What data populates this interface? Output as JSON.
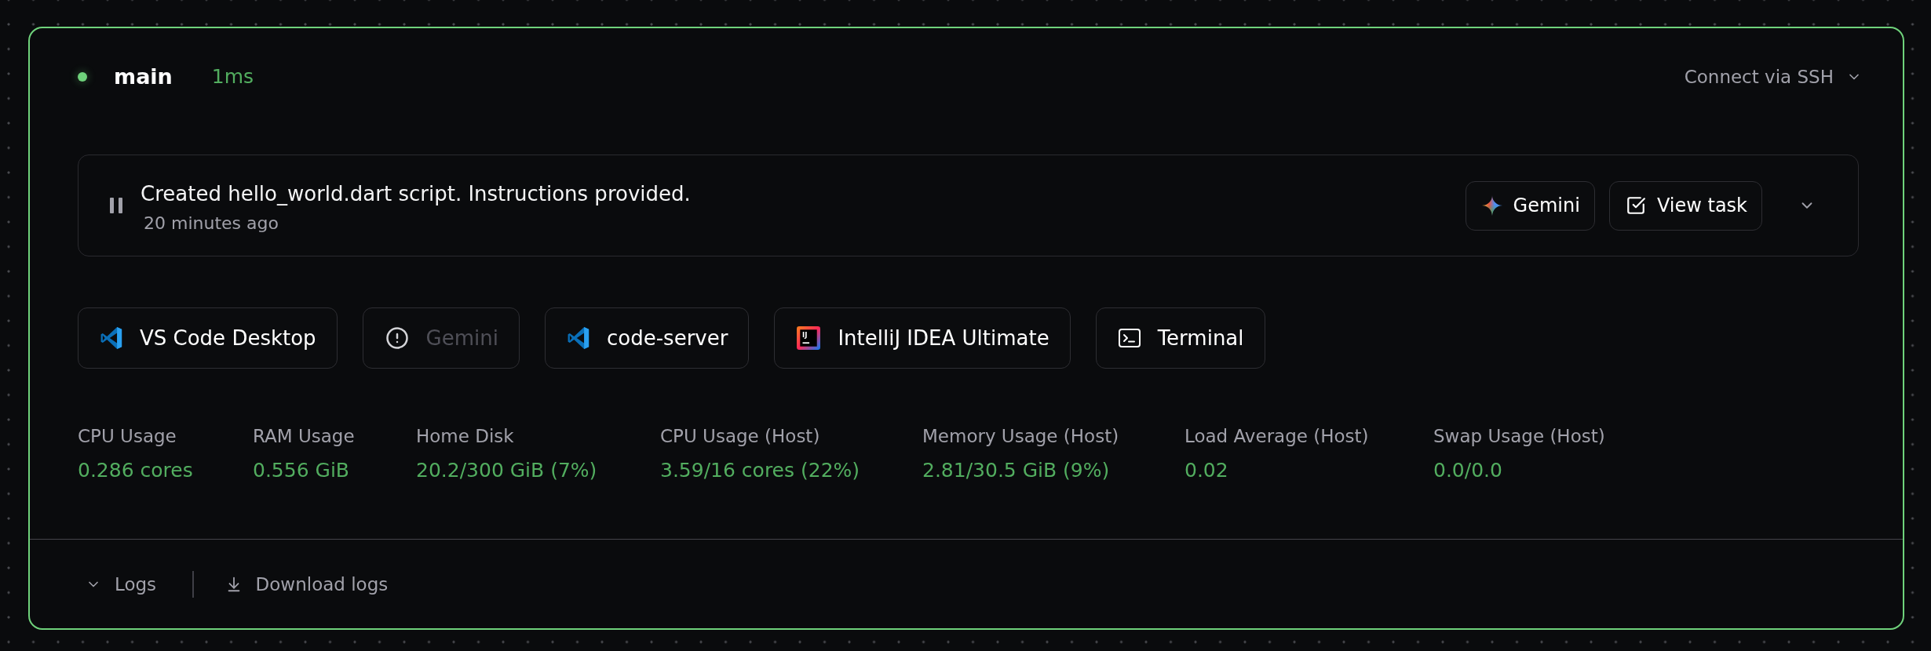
{
  "workspace": {
    "connected": true,
    "name": "main",
    "latency": "1ms",
    "ssh": {
      "label": "Connect via SSH"
    }
  },
  "task": {
    "message": "Created hello_world.dart script. Instructions provided.",
    "time": "20 minutes ago",
    "actions": [
      {
        "kind": "gemini",
        "label": "Gemini"
      },
      {
        "kind": "view",
        "label": "View task"
      }
    ]
  },
  "apps": [
    {
      "kind": "vscode",
      "label": "VS Code Desktop",
      "disabled": false
    },
    {
      "kind": "gemini",
      "label": "Gemini",
      "disabled": true
    },
    {
      "kind": "vscode",
      "label": "code-server",
      "disabled": false
    },
    {
      "kind": "intellij",
      "label": "IntelliJ IDEA Ultimate",
      "logo_text": "IJ",
      "disabled": false
    },
    {
      "kind": "terminal",
      "label": "Terminal",
      "disabled": false
    }
  ],
  "metrics": [
    {
      "label": "CPU Usage",
      "value": "0.286 cores"
    },
    {
      "label": "RAM Usage",
      "value": "0.556 GiB"
    },
    {
      "label": "Home Disk",
      "value": "20.2/300 GiB (7%)"
    },
    {
      "label": "CPU Usage (Host)",
      "value": "3.59/16 cores (22%)"
    },
    {
      "label": "Memory Usage (Host)",
      "value": "2.81/30.5 GiB (9%)"
    },
    {
      "label": "Load Average (Host)",
      "value": "0.02"
    },
    {
      "label": "Swap Usage (Host)",
      "value": "0.0/0.0"
    }
  ],
  "footer": {
    "logs": {
      "label": "Logs",
      "expanded": false
    },
    "download": {
      "label": "Download logs"
    }
  }
}
